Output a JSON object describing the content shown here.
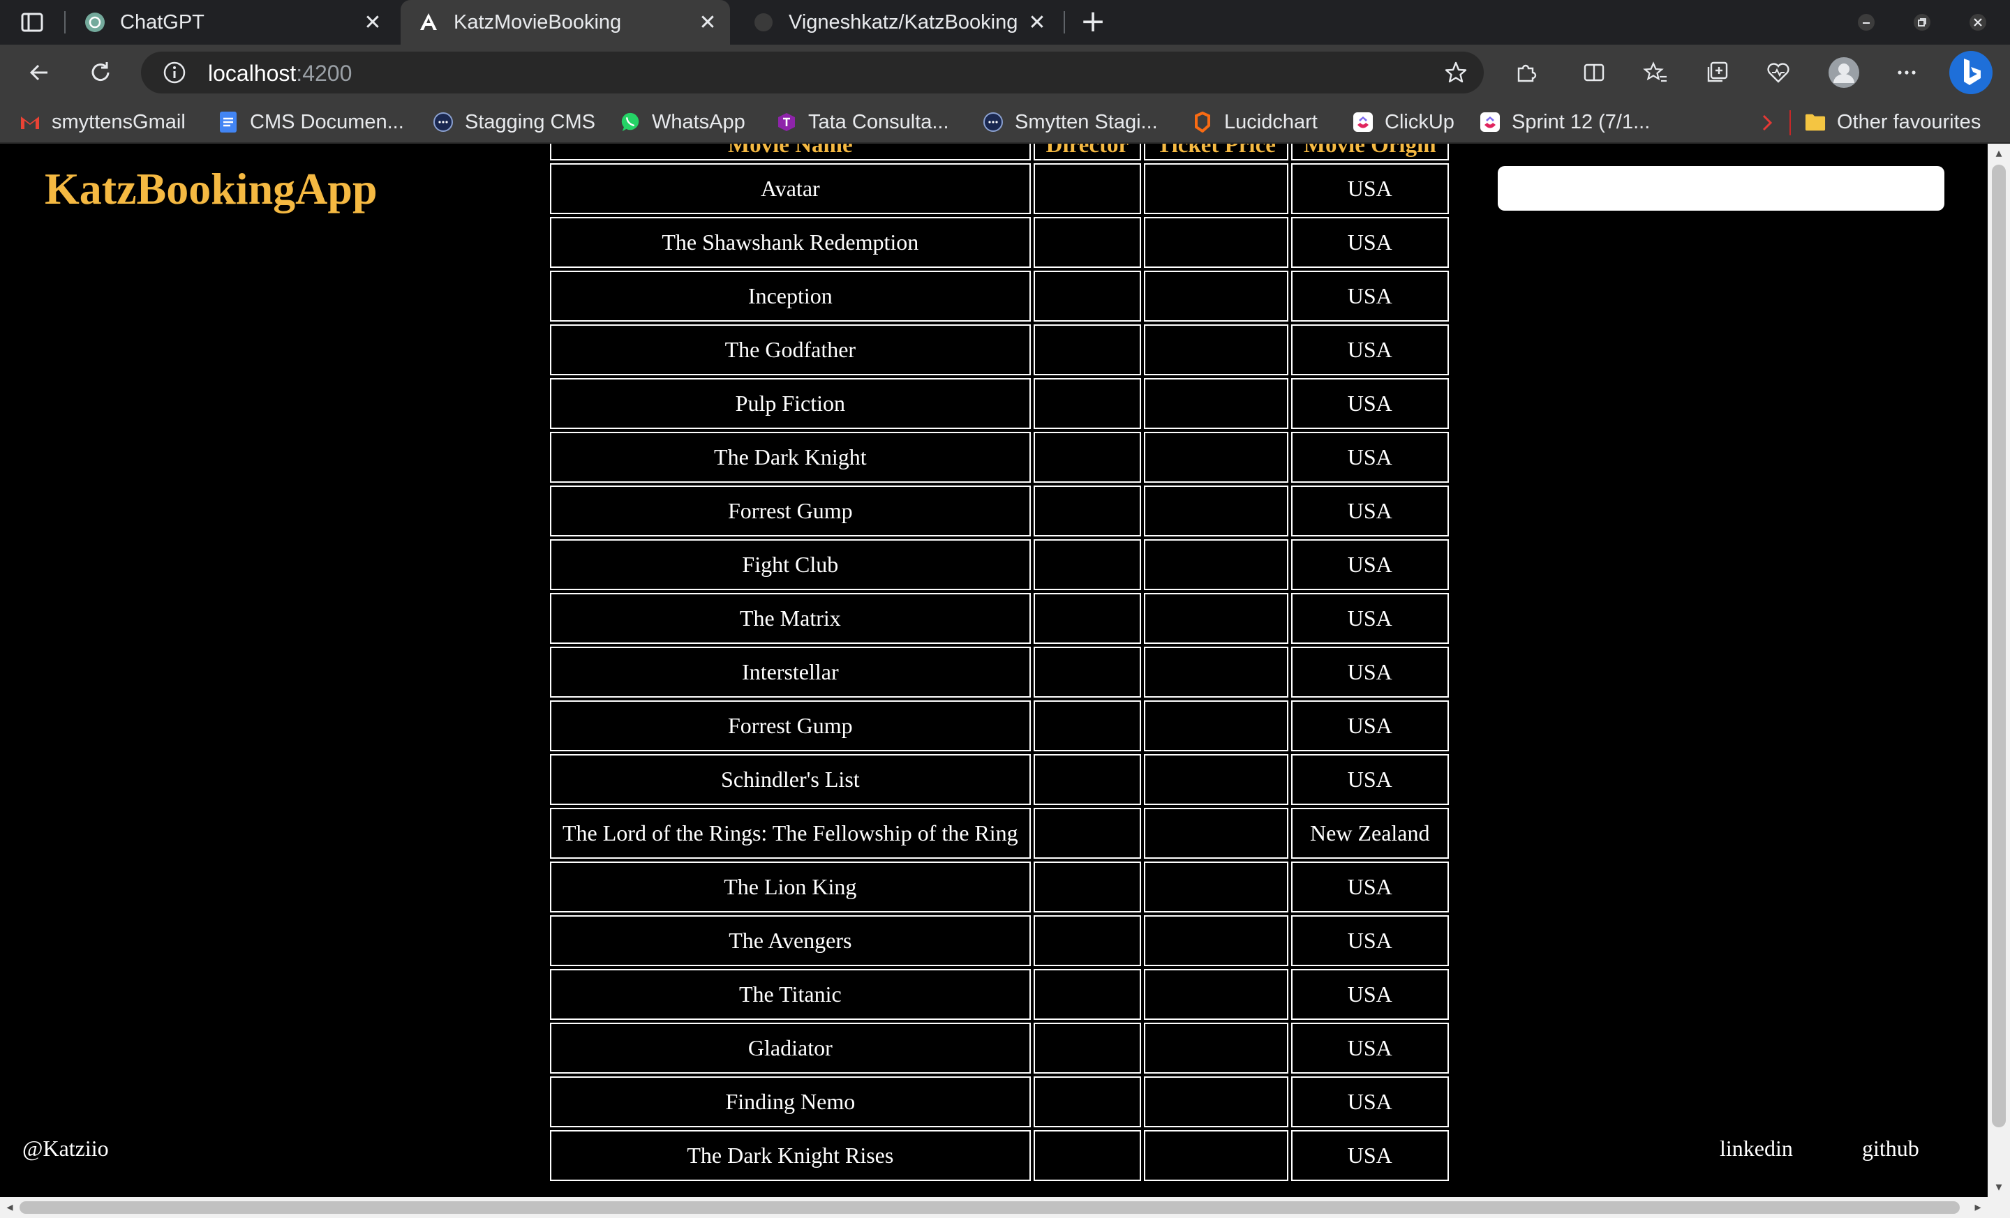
{
  "browser": {
    "tabs": [
      {
        "title": "ChatGPT",
        "icon": "chatgpt-icon",
        "active": false
      },
      {
        "title": "KatzMovieBooking",
        "icon": "angular-icon",
        "active": true
      },
      {
        "title": "Vigneshkatz/KatzBooking",
        "icon": "github-icon",
        "active": false
      }
    ],
    "address": {
      "host": "localhost",
      "port": ":4200"
    },
    "bookmarks": [
      {
        "label": "smyttensGmail",
        "icon": "gmail-icon"
      },
      {
        "label": "CMS Documen...",
        "icon": "docs-icon"
      },
      {
        "label": "Stagging CMS",
        "icon": "site-icon"
      },
      {
        "label": "WhatsApp",
        "icon": "whatsapp-icon"
      },
      {
        "label": "Tata Consulta...",
        "icon": "tcs-icon"
      },
      {
        "label": "Smytten Stagi...",
        "icon": "site-icon"
      },
      {
        "label": "Lucidchart",
        "icon": "lucidchart-icon"
      },
      {
        "label": "ClickUp",
        "icon": "clickup-icon"
      },
      {
        "label": "Sprint 12 (7/1...",
        "icon": "clickup-icon"
      },
      {
        "label": "Other favourites",
        "icon": "folder-icon"
      }
    ]
  },
  "app": {
    "brand": "KatzBookingApp",
    "search_value": "",
    "table": {
      "headers": [
        "Movie Name",
        "Director",
        "Ticket Price",
        "Movie Origin"
      ],
      "rows": [
        {
          "name": "Avatar",
          "director": "",
          "price": "",
          "origin": "USA"
        },
        {
          "name": "The Shawshank Redemption",
          "director": "",
          "price": "",
          "origin": "USA"
        },
        {
          "name": "Inception",
          "director": "",
          "price": "",
          "origin": "USA"
        },
        {
          "name": "The Godfather",
          "director": "",
          "price": "",
          "origin": "USA"
        },
        {
          "name": "Pulp Fiction",
          "director": "",
          "price": "",
          "origin": "USA"
        },
        {
          "name": "The Dark Knight",
          "director": "",
          "price": "",
          "origin": "USA"
        },
        {
          "name": "Forrest Gump",
          "director": "",
          "price": "",
          "origin": "USA"
        },
        {
          "name": "Fight Club",
          "director": "",
          "price": "",
          "origin": "USA"
        },
        {
          "name": "The Matrix",
          "director": "",
          "price": "",
          "origin": "USA"
        },
        {
          "name": "Interstellar",
          "director": "",
          "price": "",
          "origin": "USA"
        },
        {
          "name": "Forrest Gump",
          "director": "",
          "price": "",
          "origin": "USA"
        },
        {
          "name": "Schindler's List",
          "director": "",
          "price": "",
          "origin": "USA"
        },
        {
          "name": "The Lord of the Rings: The Fellowship of the Ring",
          "director": "",
          "price": "",
          "origin": "New Zealand"
        },
        {
          "name": "The Lion King",
          "director": "",
          "price": "",
          "origin": "USA"
        },
        {
          "name": "The Avengers",
          "director": "",
          "price": "",
          "origin": "USA"
        },
        {
          "name": "The Titanic",
          "director": "",
          "price": "",
          "origin": "USA"
        },
        {
          "name": "Gladiator",
          "director": "",
          "price": "",
          "origin": "USA"
        },
        {
          "name": "Finding Nemo",
          "director": "",
          "price": "",
          "origin": "USA"
        },
        {
          "name": "The Dark Knight Rises",
          "director": "",
          "price": "",
          "origin": "USA"
        }
      ]
    },
    "footer": {
      "handle": "@Katziio",
      "links": [
        "linkedin",
        "github"
      ]
    }
  },
  "colors": {
    "brand": "#f5b942",
    "background": "#000000",
    "chrome": "#3c3c3c"
  }
}
